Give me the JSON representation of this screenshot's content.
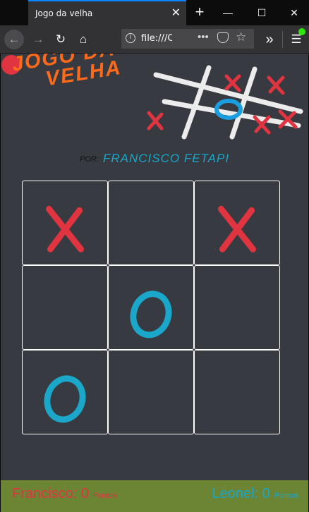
{
  "browser": {
    "tab_title": "Jogo da velha",
    "url": "file:///C",
    "icons": [
      "back-arrow-icon",
      "forward-arrow-icon",
      "reload-icon",
      "home-icon",
      "info-icon",
      "more-dots-icon",
      "pocket-icon",
      "star-icon",
      "overflow-icon",
      "menu-icon"
    ]
  },
  "page": {
    "logo_line1": "JOGO DA",
    "logo_line2": "VELHA",
    "author_prefix": "POR:",
    "author_name": "FRANCISCO FETAPI",
    "board": [
      "X",
      "",
      "X",
      "",
      "O",
      "",
      "O",
      "",
      ""
    ],
    "colors": {
      "x": "#e03440",
      "o": "#1aa7c9",
      "background": "#373a40",
      "footer": "#6b8534"
    }
  },
  "score": {
    "player1": {
      "name": "Francisco",
      "score": 0,
      "unit": "Pontos"
    },
    "player2": {
      "name": "Leonel",
      "score": 0,
      "unit": "Pontos"
    }
  }
}
